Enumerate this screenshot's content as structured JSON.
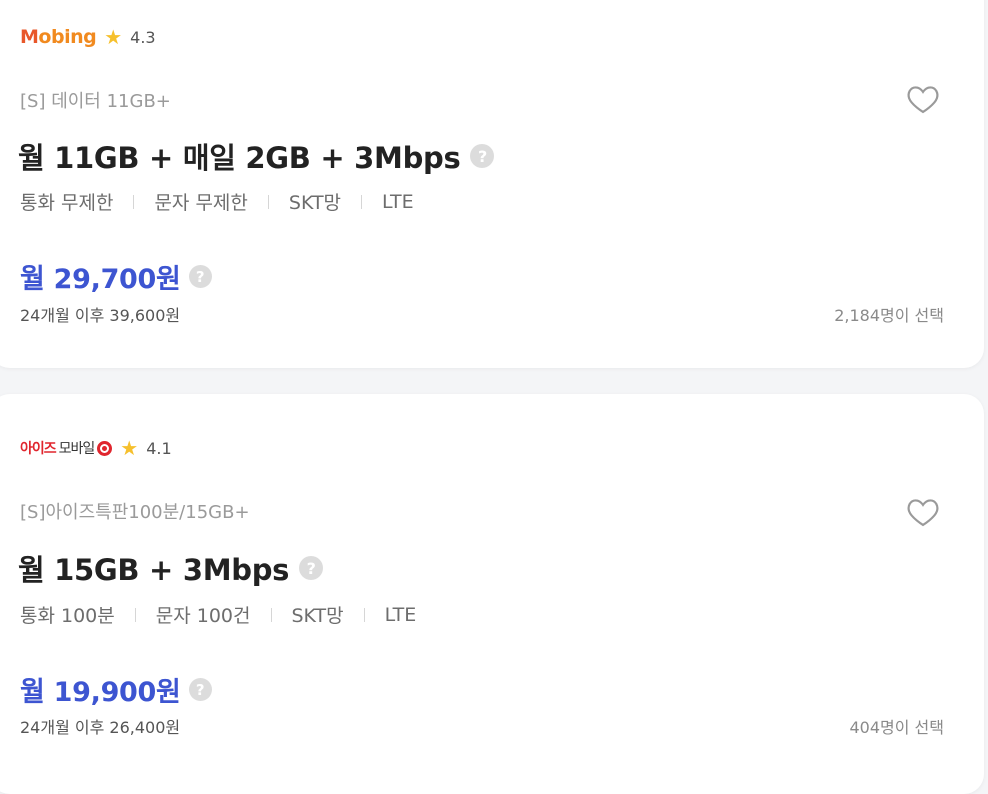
{
  "plans": [
    {
      "provider": {
        "logo_text": "Mobing",
        "logo_initial": "M",
        "logo_rest": "obing",
        "rating": "4.3"
      },
      "subtitle": "[S] 데이터 11GB+",
      "title": "월 11GB + 매일 2GB + 3Mbps",
      "specs": [
        "통화 무제한",
        "문자 무제한",
        "SKT망",
        "LTE"
      ],
      "price": "월 29,700원",
      "after_price": "24개월 이후 39,600원",
      "chosen_count": "2,184명이 선택"
    },
    {
      "provider": {
        "logo_red": "아이즈",
        "logo_dark": "모바일",
        "rating": "4.1"
      },
      "subtitle": "[S]아이즈특판100분/15GB+",
      "title": "월 15GB + 3Mbps",
      "specs": [
        "통화 100분",
        "문자 100건",
        "SKT망",
        "LTE"
      ],
      "price": "월 19,900원",
      "after_price": "24개월 이후 26,400원",
      "chosen_count": "404명이 선택"
    }
  ],
  "icons": {
    "help": "question-mark-icon",
    "favorite": "heart-outline-icon",
    "rating": "star-icon",
    "help_glyph": "?"
  },
  "colors": {
    "price": "#3d55d1",
    "star": "#f6c02d",
    "mobing_logo": "#f18a1f",
    "iz_logo": "#e0262e"
  }
}
